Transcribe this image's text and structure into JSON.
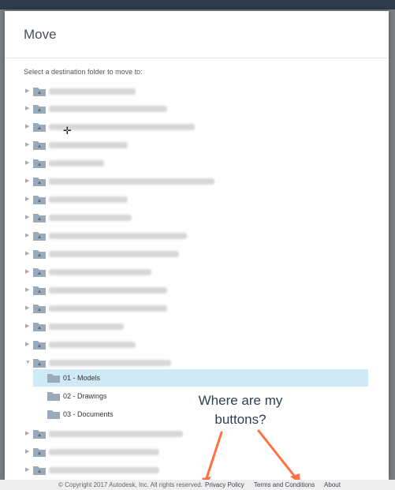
{
  "modal": {
    "title": "Move",
    "subtitle": "Select a destination folder to move to:"
  },
  "tree": {
    "expanded_children": [
      {
        "label": "01 - Models",
        "selected": true
      },
      {
        "label": "02 - Drawings",
        "selected": false
      },
      {
        "label": "03 - Documents",
        "selected": false
      }
    ]
  },
  "annotation": {
    "line1": "Where are my",
    "line2": "buttons?",
    "color": "#ff7043"
  },
  "footer": {
    "copyright": "© Copyright 2017 Autodesk, Inc. All rights reserved.",
    "privacy": "Privacy Policy",
    "terms": "Terms and Conditions",
    "about": "About"
  },
  "colors": {
    "selected_row": "#cfeaf6",
    "folder": "#9aaab8",
    "title": "#4a4f55"
  },
  "icons": [
    "caret-right-icon",
    "caret-down-icon",
    "project-folder-icon",
    "folder-icon",
    "move-cursor-icon"
  ]
}
